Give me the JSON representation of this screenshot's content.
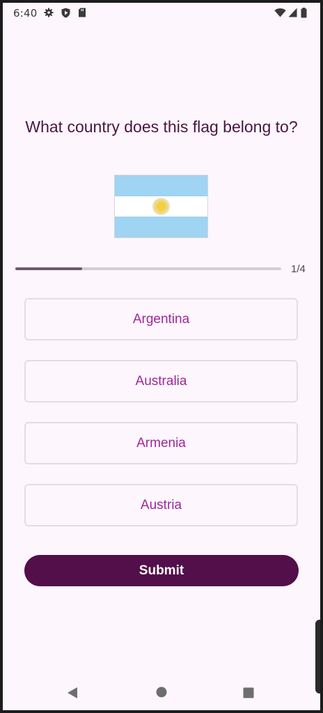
{
  "status_bar": {
    "time": "6:40",
    "left_icons": [
      "settings-gear-icon",
      "shield-play-icon",
      "sd-card-icon"
    ],
    "right_icons": [
      "wifi-icon",
      "signal-icon",
      "battery-icon"
    ]
  },
  "quiz": {
    "question": "What country does this flag belong to?",
    "flag": {
      "name": "argentina-flag",
      "colors": {
        "blue": "#9fd4f2",
        "white": "#ffffff",
        "sun": "#f4d24a"
      }
    },
    "progress": {
      "current": 1,
      "total": 4,
      "fraction": 0.25,
      "label": "1/4"
    },
    "options": [
      {
        "label": "Argentina"
      },
      {
        "label": "Australia"
      },
      {
        "label": "Armenia"
      },
      {
        "label": "Austria"
      }
    ],
    "submit_label": "Submit"
  },
  "nav_bar": {
    "buttons": [
      "back-triangle-icon",
      "home-circle-icon",
      "recents-square-icon"
    ]
  },
  "colors": {
    "background": "#fdf7fd",
    "question_text": "#4a1542",
    "option_text": "#a0269a",
    "option_border": "#e3dde3",
    "submit_bg": "#520f4a",
    "progress_fill": "#6c5a70",
    "progress_track": "#d3ccd4"
  }
}
